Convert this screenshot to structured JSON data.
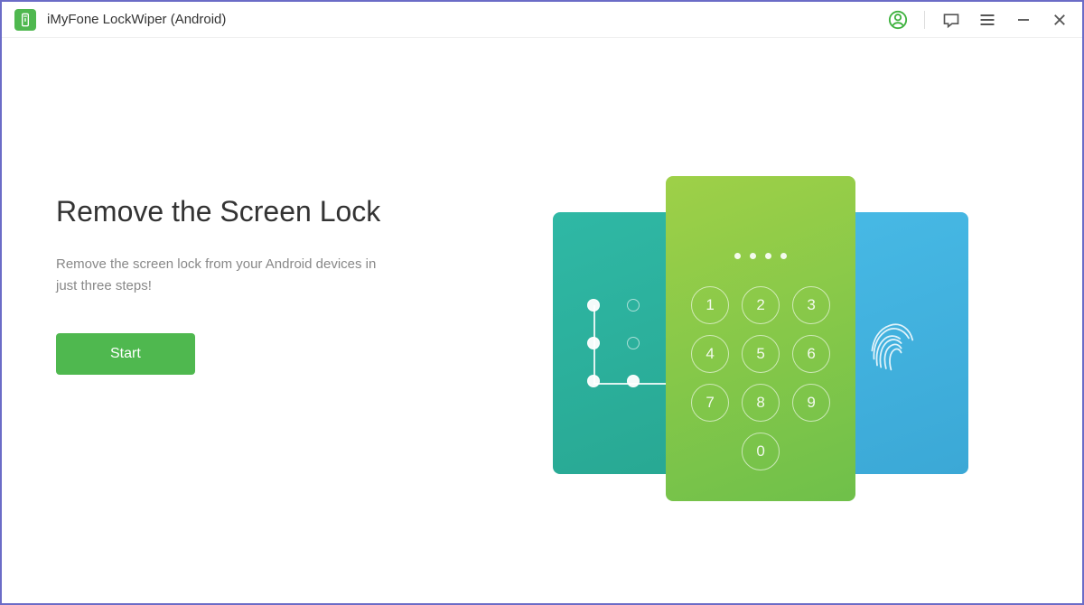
{
  "titlebar": {
    "app_title": "iMyFone LockWiper (Android)"
  },
  "main": {
    "heading": "Remove the Screen Lock",
    "description": "Remove the screen lock from your Android devices in just three steps!",
    "start_button_label": "Start"
  },
  "keypad": {
    "keys": [
      "1",
      "2",
      "3",
      "4",
      "5",
      "6",
      "7",
      "8",
      "9",
      "0"
    ]
  },
  "icons": {
    "account": "account-icon",
    "feedback": "feedback-icon",
    "menu": "menu-icon",
    "minimize": "minimize-icon",
    "close": "close-icon"
  },
  "colors": {
    "brand_green": "#4fb84f",
    "card_teal": "#2fb8a5",
    "card_green": "#8fcb47",
    "card_blue": "#47b9e5"
  }
}
